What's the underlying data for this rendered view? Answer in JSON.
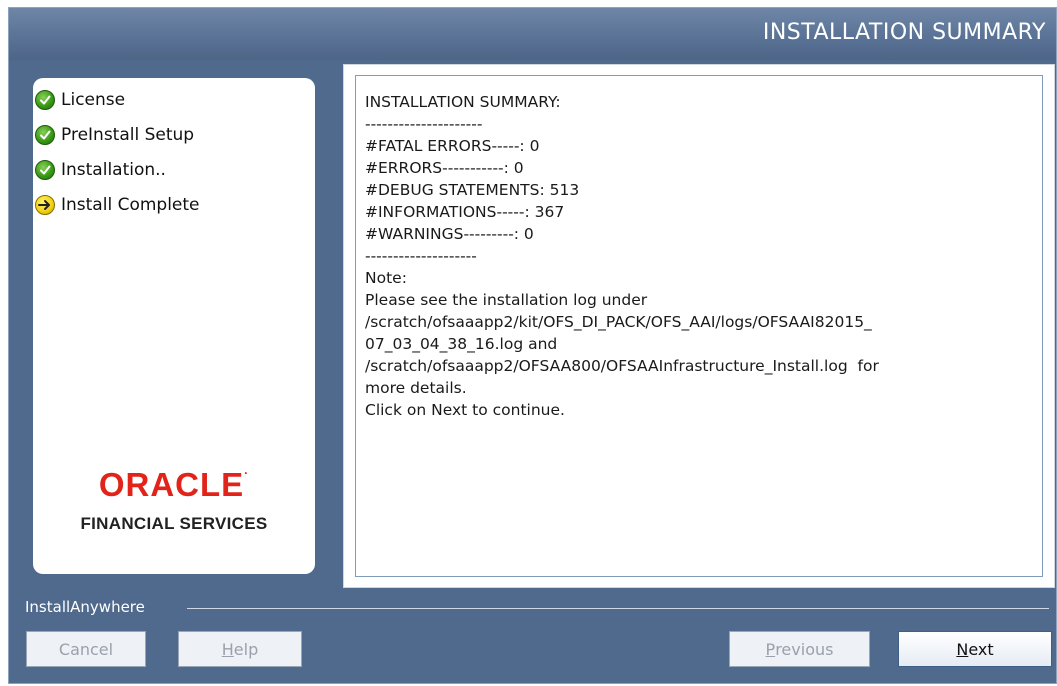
{
  "header": {
    "title": "INSTALLATION SUMMARY"
  },
  "steps": [
    {
      "label": "License",
      "status": "done"
    },
    {
      "label": "PreInstall Setup",
      "status": "done"
    },
    {
      "label": "Installation..",
      "status": "done"
    },
    {
      "label": "Install Complete",
      "status": "current"
    }
  ],
  "logo": {
    "brand": "ORACLE",
    "tm": "·",
    "subtitle": "FINANCIAL SERVICES"
  },
  "summary": {
    "lines": [
      "INSTALLATION SUMMARY:",
      "---------------------",
      "#FATAL ERRORS-----: 0",
      "#ERRORS-----------: 0",
      "#DEBUG STATEMENTS: 513",
      "#INFORMATIONS-----: 367",
      "#WARNINGS---------: 0",
      "--------------------",
      "Note:",
      "Please see the installation log under",
      "/scratch/ofsaaapp2/kit/OFS_DI_PACK/OFS_AAI/logs/OFSAAI82015_",
      "07_03_04_38_16.log and",
      "/scratch/ofsaaapp2/OFSAA800/OFSAAInfrastructure_Install.log  for",
      "more details.",
      "Click on Next to continue."
    ]
  },
  "footer": {
    "installer_label": "InstallAnywhere",
    "cancel_label": "Cancel",
    "help_label": "Help",
    "previous_label": "Previous",
    "next_label": "Next"
  },
  "colors": {
    "window_bg": "#4f6a8c",
    "brand_red": "#e2231a",
    "check_green": "#3a9a16",
    "arrow_yellow": "#f1cf12"
  }
}
